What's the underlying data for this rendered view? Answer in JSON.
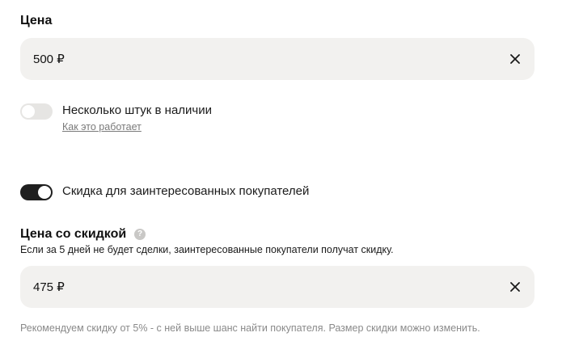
{
  "price": {
    "title": "Цена",
    "value": "500 ₽"
  },
  "multiple_items": {
    "toggle_on": false,
    "label": "Несколько штук в наличии",
    "link": "Как это работает"
  },
  "discount": {
    "toggle_on": true,
    "label": "Скидка для заинтересованных покупателей"
  },
  "discount_price": {
    "title": "Цена со скидкой",
    "help_glyph": "?",
    "description": "Если за 5 дней не будет сделки, заинтересованные покупатели получат скидку.",
    "value": "475 ₽",
    "hint": "Рекомендуем скидку от 5% - с ней выше шанс найти покупателя. Размер скидки можно изменить."
  },
  "colors": {
    "field_bg": "#f2f1ef",
    "toggle_on": "#1f1f1f",
    "toggle_off": "#e6e5e3",
    "muted_text": "#8a8a8a"
  }
}
